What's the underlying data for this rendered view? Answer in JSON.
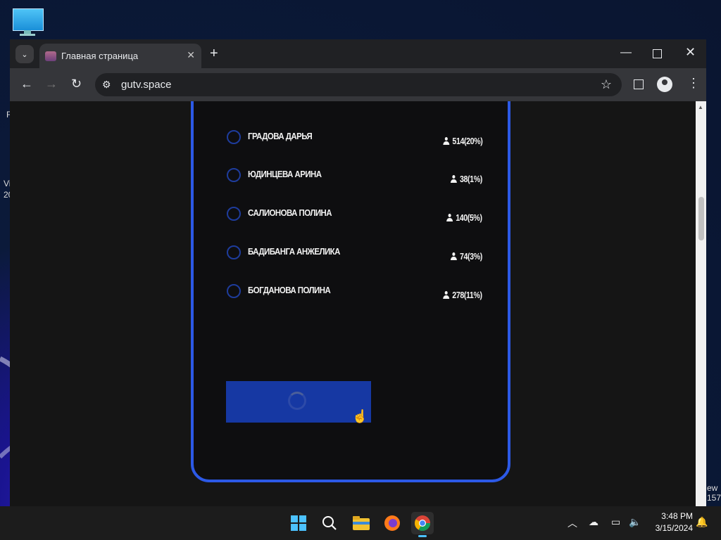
{
  "desktop": {
    "edge_text_left": [
      "R",
      "Vi",
      "20"
    ],
    "edge_text_right": [
      "ew",
      "157"
    ]
  },
  "browser": {
    "tab": {
      "title": "Главная страница"
    },
    "address": {
      "url": "gutv.space"
    }
  },
  "poll": {
    "candidates": [
      {
        "name": "ГРАДОВА ДАРЬЯ",
        "votes": "514(20%)"
      },
      {
        "name": "ЮДИНЦЕВА АРИНА",
        "votes": "38(1%)"
      },
      {
        "name": "САЛИОНОВА ПОЛИНА",
        "votes": "140(5%)"
      },
      {
        "name": "БАДИБАНГА АНЖЕЛИКА",
        "votes": "74(3%)"
      },
      {
        "name": "БОГДАНОВА ПОЛИНА",
        "votes": "278(11%)"
      }
    ],
    "submit_state": "loading"
  },
  "taskbar": {
    "apps": [
      "start",
      "search",
      "file-explorer",
      "firefox",
      "chrome"
    ],
    "active_app": "chrome",
    "time": "3:48 PM",
    "date": "3/15/2024"
  },
  "colors": {
    "card_border": "#2c59e6",
    "button_bg": "#1638a3",
    "radio_border": "#1e3c9c"
  }
}
